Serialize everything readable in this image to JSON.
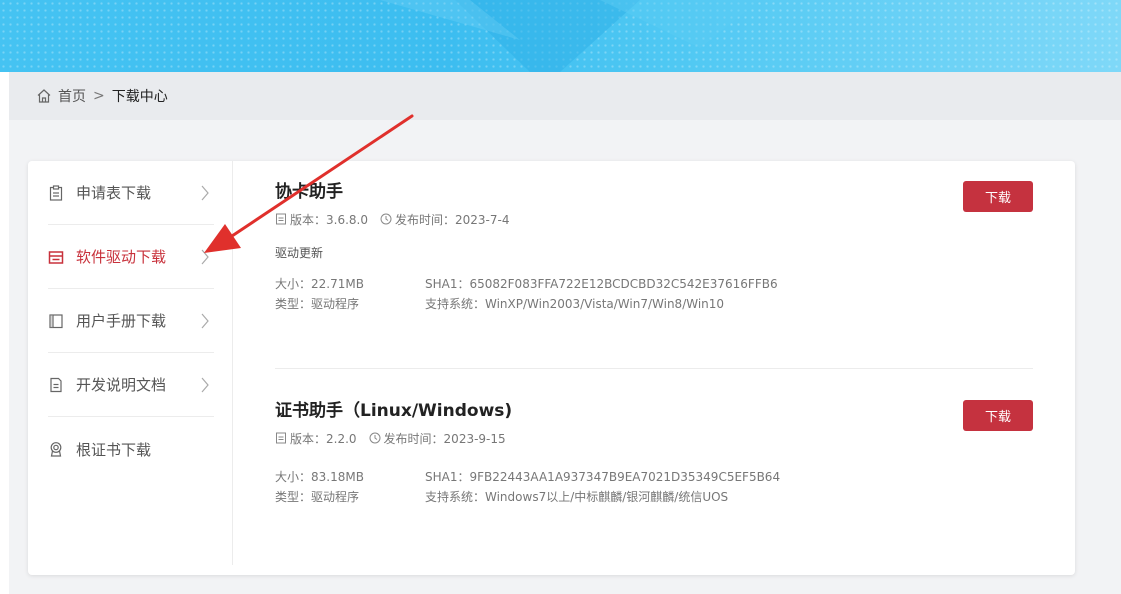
{
  "breadcrumb": {
    "home_label": "首页",
    "separator": ">",
    "current": "下载中心"
  },
  "sidebar": {
    "items": [
      {
        "label": "申请表下载",
        "icon": "clipboard-icon",
        "active": false
      },
      {
        "label": "软件驱动下载",
        "icon": "printer-icon",
        "active": true
      },
      {
        "label": "用户手册下载",
        "icon": "book-icon",
        "active": false
      },
      {
        "label": "开发说明文档",
        "icon": "document-icon",
        "active": false
      },
      {
        "label": "根证书下载",
        "icon": "badge-icon",
        "active": false
      }
    ]
  },
  "downloads": [
    {
      "title": "协卡助手",
      "version": "版本：3.6.8.0",
      "release": "发布时间：2023-7-4",
      "subtitle": "驱动更新",
      "size": "大小：22.71MB",
      "sha1": "SHA1：65082F083FFA722E12BCDCBD32C542E37616FFB6",
      "type": "类型：驱动程序",
      "systems": "支持系统：WinXP/Win2003/Vista/Win7/Win8/Win10",
      "button": "下载"
    },
    {
      "title": "证书助手（Linux/Windows)",
      "version": "版本：2.2.0",
      "release": "发布时间：2023-9-15",
      "size": "大小：83.18MB",
      "sha1": "SHA1：9FB22443AA1A937347B9EA7021D35349C5EF5B64",
      "type": "类型：驱动程序",
      "systems": "支持系统：Windows7以上/中标麒麟/银河麒麟/统信UOS",
      "button": "下载"
    }
  ],
  "colors": {
    "accent": "#c5323f",
    "banner": "#3cbdf0",
    "annotation_arrow": "#e0302c"
  }
}
